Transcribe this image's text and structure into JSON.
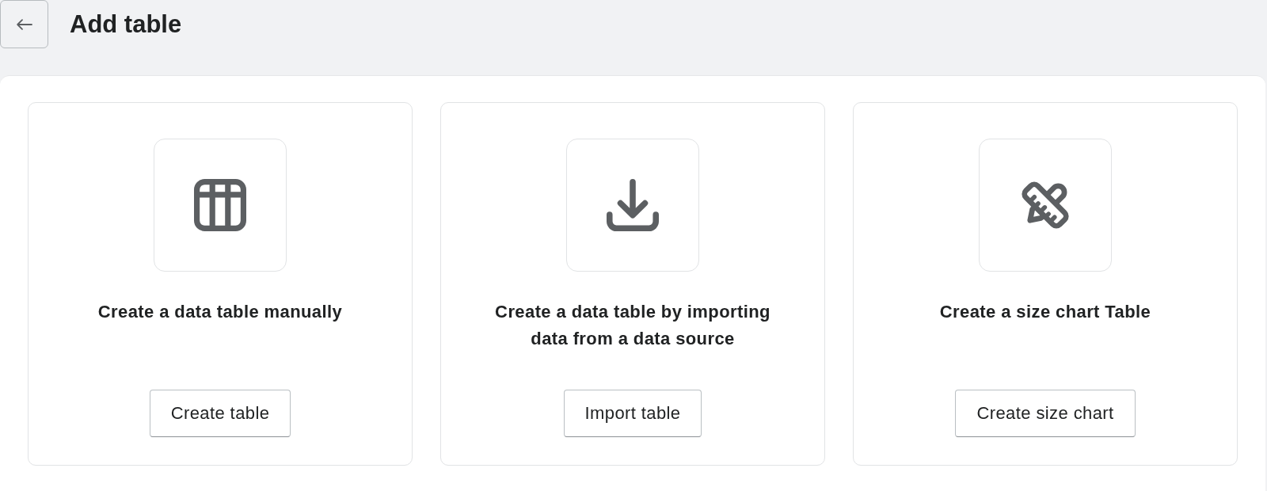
{
  "header": {
    "title": "Add table"
  },
  "options": [
    {
      "kind": "table",
      "title": "Create a data table manually",
      "button": "Create table"
    },
    {
      "kind": "import",
      "title": "Create a data table by importing data from a data source",
      "button": "Import table"
    },
    {
      "kind": "ruler-pencil",
      "title": "Create a size chart Table",
      "button": "Create size chart"
    }
  ]
}
